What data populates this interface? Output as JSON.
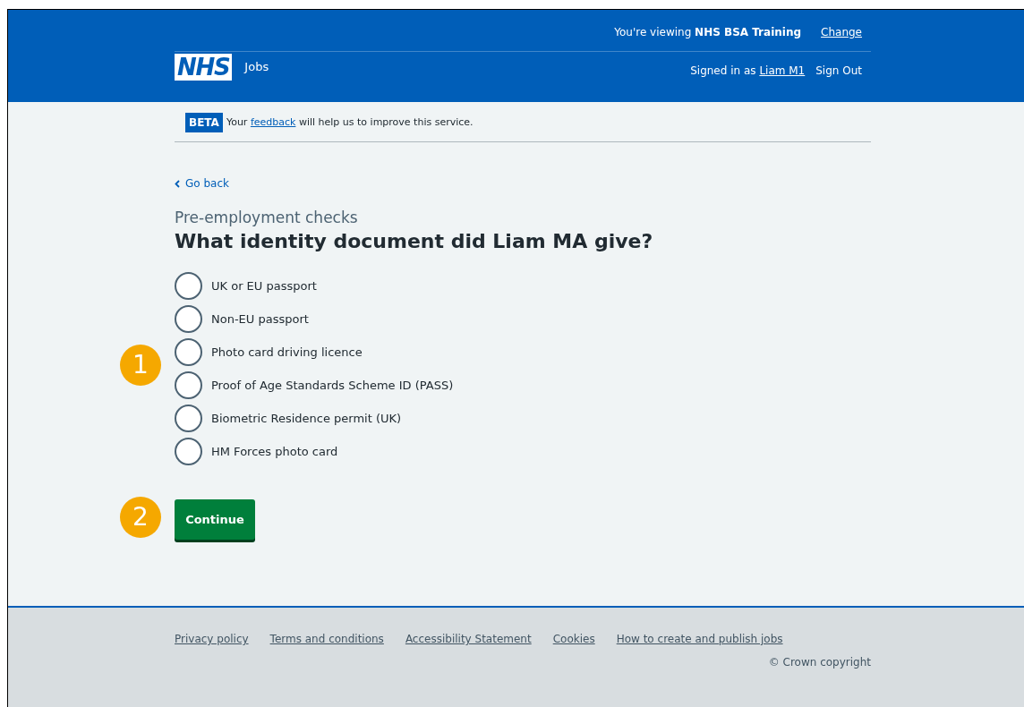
{
  "header": {
    "logo": "NHS",
    "service": "Jobs",
    "viewing": "You're viewing **NHS BSA Training**",
    "change_link": "Change",
    "signed_in_prefix": "Signed in as",
    "user_link": "Liam M1",
    "sign_out": "Sign Out"
  },
  "beta": {
    "tag": "BETA",
    "before": "Your",
    "link": "feedback",
    "after": "will help us to improve this service."
  },
  "back_link": "Go back",
  "caption": "Pre-employment checks",
  "heading": "What identity document did Liam MA give?",
  "options": [
    {
      "label": "UK or EU passport",
      "selected": false
    },
    {
      "label": "Non-EU passport",
      "selected": false
    },
    {
      "label": "Photo card driving licence",
      "selected": false
    },
    {
      "label": "Proof of Age Standards Scheme ID (PASS)",
      "selected": false
    },
    {
      "label": "Biometric Residence permit (UK)",
      "selected": false
    },
    {
      "label": "HM Forces photo card",
      "selected": false
    }
  ],
  "callouts": [
    "1",
    "2"
  ],
  "continue_button": "Continue",
  "footer": {
    "links": [
      "Privacy policy",
      "Terms and conditions",
      "Accessibility Statement",
      "Cookies",
      "How to create and publish jobs"
    ],
    "copyright": "© Crown copyright"
  }
}
